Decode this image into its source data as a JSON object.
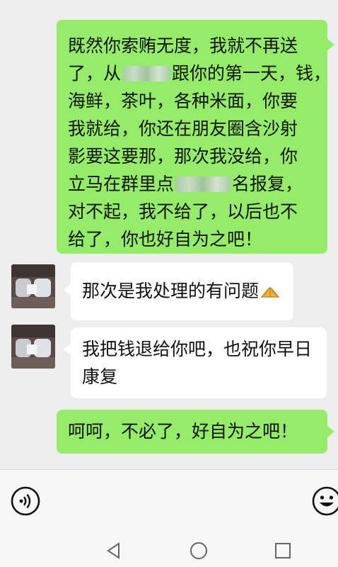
{
  "conversation": {
    "sent_1": {
      "line_1": "既然你索贿无度，我就不再送",
      "line_2_a": "了，从",
      "line_2_b": "跟你的第一天，钱，",
      "line_3": "海鲜，茶叶，各种米面，你要",
      "line_4": "我就给，你还在朋友圈含沙射",
      "line_5": "影要这要那，那次我没给，你",
      "line_6_a": "立马在群里点",
      "line_6_b": "名报复，",
      "line_7": "对不起，我不给了，以后也不",
      "line_8": "给了，你也好自为之吧！"
    },
    "received_1": {
      "text": "那次是我处理的有问题",
      "emoji": "clasped-hands-icon"
    },
    "received_2": {
      "line_1": "我把钱退给你吧，也祝你早日",
      "line_2": "康复"
    },
    "sent_2": {
      "text": "呵呵，不必了，好自为之吧！"
    }
  },
  "input_bar": {
    "left_icon": "voice-input-icon",
    "right_icon": "emoji-icon"
  },
  "system_nav": {
    "back_icon": "back-triangle-icon",
    "home_icon": "home-circle-icon",
    "recent_icon": "recent-apps-square-icon"
  },
  "colors": {
    "chat_background": "#ededed",
    "sent_bubble": "#95ec69",
    "received_bubble": "#ffffff"
  }
}
